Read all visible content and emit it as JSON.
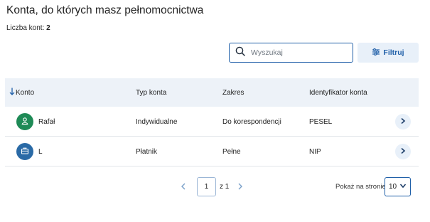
{
  "header": {
    "title": "Konta, do których masz pełnomocnictwa",
    "count_label": "Liczba kont:",
    "count_value": "2"
  },
  "toolbar": {
    "search_placeholder": "Wyszukaj",
    "search_value": "",
    "filter_label": "Filtruj"
  },
  "table": {
    "columns": [
      "Konto",
      "Typ konta",
      "Zakres",
      "Identyfikator konta"
    ],
    "sort_column": "Konto",
    "rows": [
      {
        "name": "Rafał",
        "avatar_icon": "person-icon",
        "avatar_color": "#1e8a56",
        "type": "Indywidualne",
        "scope": "Do korespondencji",
        "identifier": "PESEL"
      },
      {
        "name": "L",
        "avatar_icon": "briefcase-icon",
        "avatar_color": "#2a6aa6",
        "type": "Płatnik",
        "scope": "Pełne",
        "identifier": "NIP"
      }
    ]
  },
  "pagination": {
    "current_page": "1",
    "of_label": "z 1",
    "per_page_label": "Pokaż na stronie",
    "per_page_value": "10"
  },
  "colors": {
    "accent": "#1f5fa8",
    "header_bg": "#edf2f8",
    "button_bg": "#e8f0f9"
  }
}
